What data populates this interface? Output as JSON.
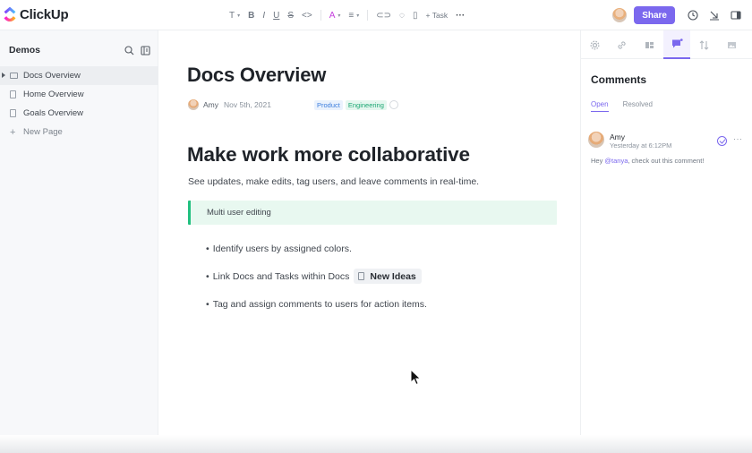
{
  "app": {
    "name": "ClickUp"
  },
  "toolbar": {
    "items": [
      {
        "name": "text-style-icon",
        "glyph": "T",
        "caret": true
      },
      {
        "name": "bold-icon",
        "glyph": "B"
      },
      {
        "name": "italic-icon",
        "glyph": "I"
      },
      {
        "name": "underline-icon",
        "glyph": "U"
      },
      {
        "name": "strikethrough-icon",
        "glyph": "S"
      },
      {
        "name": "code-icon",
        "glyph": "<>"
      },
      {
        "name": "text-color-icon",
        "glyph": "A",
        "caret": true,
        "color": "#c53fde"
      },
      {
        "name": "align-icon",
        "glyph": "≡",
        "caret": true
      },
      {
        "name": "link-icon",
        "glyph": "⊂⊃"
      },
      {
        "name": "comment-icon",
        "glyph": "◌"
      },
      {
        "name": "doc-link-icon",
        "glyph": "▯"
      }
    ],
    "task_label": "+ Task",
    "more_glyph": "···"
  },
  "header": {
    "share_label": "Share"
  },
  "sidebar": {
    "title": "Demos",
    "items": [
      {
        "label": "Docs Overview",
        "active": true
      },
      {
        "label": "Home Overview"
      },
      {
        "label": "Goals Overview"
      },
      {
        "label": "New Page"
      }
    ]
  },
  "doc": {
    "title": "Docs Overview",
    "author": "Amy",
    "date": "Nov 5th, 2021",
    "tags": [
      "Product",
      "Engineering"
    ],
    "heading": "Make work more collaborative",
    "lead": "See updates, make edits, tag users, and leave comments in real-time.",
    "callout": "Multi user editing",
    "bullets": [
      "Identify users by assigned colors.",
      "Link Docs and Tasks within Docs",
      "Tag and assign comments to users for action items."
    ],
    "linked_doc": "New Ideas",
    "bullet_glyph": "•"
  },
  "comments": {
    "title": "Comments",
    "filters": [
      "Open",
      "Resolved"
    ],
    "comment": {
      "author": "Amy",
      "time": "Yesterday at 6:12PM",
      "text_before": "Hey ",
      "mention": "@tanya",
      "text_after": ", check out this comment!"
    },
    "more_glyph": "···"
  },
  "colors": {
    "accent": "#7b68ee",
    "callout_bg": "#e8f8f0",
    "callout_border": "#21c07f",
    "tag_product": "#3b7ddd",
    "tag_engineering": "#1aa672"
  }
}
